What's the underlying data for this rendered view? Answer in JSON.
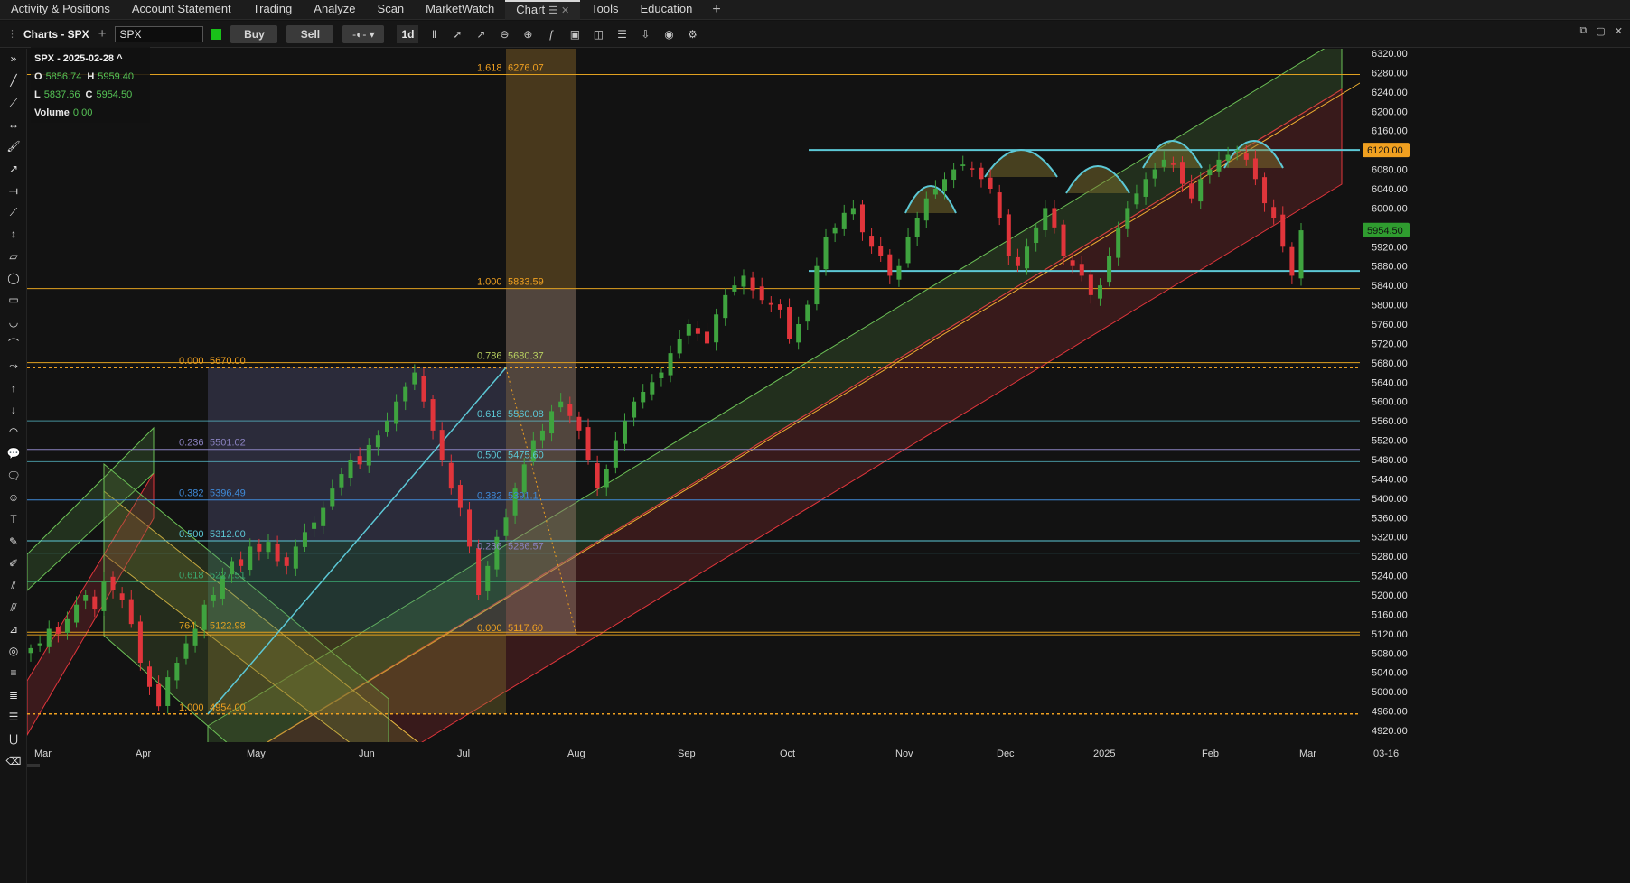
{
  "nav_tabs": [
    {
      "label": "Activity & Positions"
    },
    {
      "label": "Account Statement"
    },
    {
      "label": "Trading"
    },
    {
      "label": "Analyze"
    },
    {
      "label": "Scan"
    },
    {
      "label": "MarketWatch"
    },
    {
      "label": "Chart",
      "active": true
    },
    {
      "label": "Tools"
    },
    {
      "label": "Education"
    }
  ],
  "toolbar": {
    "title": "Charts - SPX",
    "symbol": "SPX",
    "buy_label": "Buy",
    "sell_label": "Sell",
    "period_label": "1d"
  },
  "legend": {
    "symbol_date": "SPX - 2025-02-28",
    "caret": "^",
    "open_key": "O",
    "open": "5856.74",
    "high_key": "H",
    "high": "5959.40",
    "low_key": "L",
    "low": "5837.66",
    "close_key": "C",
    "close": "5954.50",
    "volume_key": "Volume",
    "volume": "0.00"
  },
  "colors": {
    "background": "#121212",
    "up": "#3fa33f",
    "down": "#e0353b",
    "fib": "#f0a020",
    "cyan": "#5cc8d6",
    "price_tag_orange": "#f0a020",
    "price_tag_green": "#2f9c2f"
  },
  "price_axis": {
    "ticks": [
      "6320.00",
      "6280.00",
      "6240.00",
      "6200.00",
      "6160.00",
      "6120.00",
      "6080.00",
      "6040.00",
      "6000.00",
      "5960.00",
      "5920.00",
      "5880.00",
      "5840.00",
      "5800.00",
      "5760.00",
      "5720.00",
      "5680.00",
      "5640.00",
      "5600.00",
      "5560.00",
      "5520.00",
      "5480.00",
      "5440.00",
      "5400.00",
      "5360.00",
      "5320.00",
      "5280.00",
      "5240.00",
      "5200.00",
      "5160.00",
      "5120.00",
      "5080.00",
      "5040.00",
      "5000.00",
      "4960.00",
      "4920.00"
    ],
    "resistance_tag": "6120.00",
    "last_price_tag": "5954.50"
  },
  "time_axis": {
    "labels": [
      "Mar",
      "Apr",
      "May",
      "Jun",
      "Jul",
      "Aug",
      "Sep",
      "Oct",
      "Nov",
      "Dec",
      "2025",
      "Jan",
      "Feb",
      "Mar",
      "03-16"
    ]
  },
  "fib_left": [
    {
      "ratio": "0.000",
      "price": "5670.00"
    },
    {
      "ratio": "0.236",
      "price": "5501.02"
    },
    {
      "ratio": "0.382",
      "price": "5396.49"
    },
    {
      "ratio": "0.500",
      "price": "5312.00"
    },
    {
      "ratio": "0.618",
      "price": "5227.51"
    },
    {
      "ratio": "764",
      "price": "5122.98"
    },
    {
      "ratio": "1.000",
      "price": "4954.00"
    }
  ],
  "fib_right": [
    {
      "ratio": "1.618",
      "price": "6276.07"
    },
    {
      "ratio": "1.000",
      "price": "5833.59"
    },
    {
      "ratio": "0.786",
      "price": "5680.37"
    },
    {
      "ratio": "0.618",
      "price": "5560.08"
    },
    {
      "ratio": "0.500",
      "price": "5475.60"
    },
    {
      "ratio": "0.382",
      "price": "5391.1"
    },
    {
      "ratio": "0.236",
      "price": "5286.57"
    },
    {
      "ratio": "0.000",
      "price": "5117.60"
    }
  ],
  "rail_icons": [
    "double-chevron-right-icon",
    "trend-line-icon",
    "ray-icon",
    "horizontal-line-icon",
    "paint-roller-icon",
    "arrow-up-right-icon",
    "horizontal-ray-icon",
    "extended-line-icon",
    "vertical-line-icon",
    "parallelogram-icon",
    "ellipse-icon",
    "rectangle-icon",
    "arc-icon",
    "curve-tool-icon",
    "path-icon",
    "arrow-up-icon",
    "arrow-down-icon",
    "semicircle-icon",
    "callout-icon",
    "comment-icon",
    "emoji-icon",
    "text-icon",
    "highlighter-icon",
    "pencil-icon",
    "pitchfork-icon",
    "schiff-pitchfork-icon",
    "fib-fan-icon",
    "fib-arc-icon",
    "fib-retracement-icon",
    "fib-extension-icon",
    "fib-channel-icon",
    "magnet-icon",
    "eraser-icon"
  ]
}
